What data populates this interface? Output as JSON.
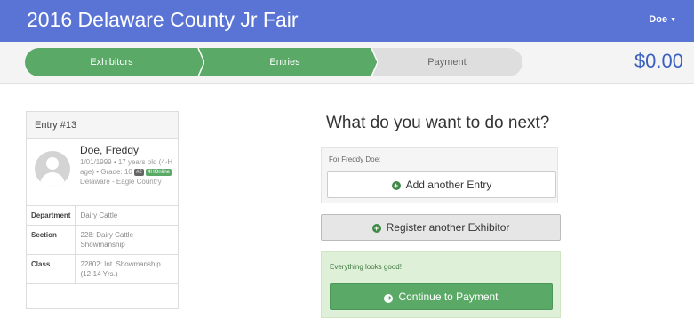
{
  "header": {
    "title": "2016 Delaware County Jr Fair",
    "user": "Doe"
  },
  "steps": [
    {
      "label": "Exhibitors",
      "state": "done"
    },
    {
      "label": "Entries",
      "state": "done"
    },
    {
      "label": "Payment",
      "state": "pending"
    }
  ],
  "cart_total": "$0.00",
  "entry": {
    "heading": "Entry #13",
    "name": "Doe, Freddy",
    "details": "1/01/1999 • 17 years old (4-H age) • Grade: 10",
    "badge_number": "#2",
    "badge_program": "4HOnline",
    "location": "Delaware - Eagle Country",
    "rows": [
      {
        "key": "Department",
        "value": "Dairy Cattle"
      },
      {
        "key": "Section",
        "value": "228: Dairy Cattle Showmanship"
      },
      {
        "key": "Class",
        "value": "22802: Int. Showmanship (12-14 Yrs.)"
      }
    ]
  },
  "next": {
    "title": "What do you want to do next?",
    "for_label": "For Freddy Doe:",
    "add_entry": "Add another Entry",
    "register_exhibitor": "Register another Exhibitor",
    "status": "Everything looks good!",
    "continue": "Continue to Payment"
  },
  "colors": {
    "header": "#5a74d6",
    "step_done": "#5aa966",
    "step_pending": "#dedede",
    "total": "#3a5fbf",
    "success_bg": "#dff0d8"
  }
}
